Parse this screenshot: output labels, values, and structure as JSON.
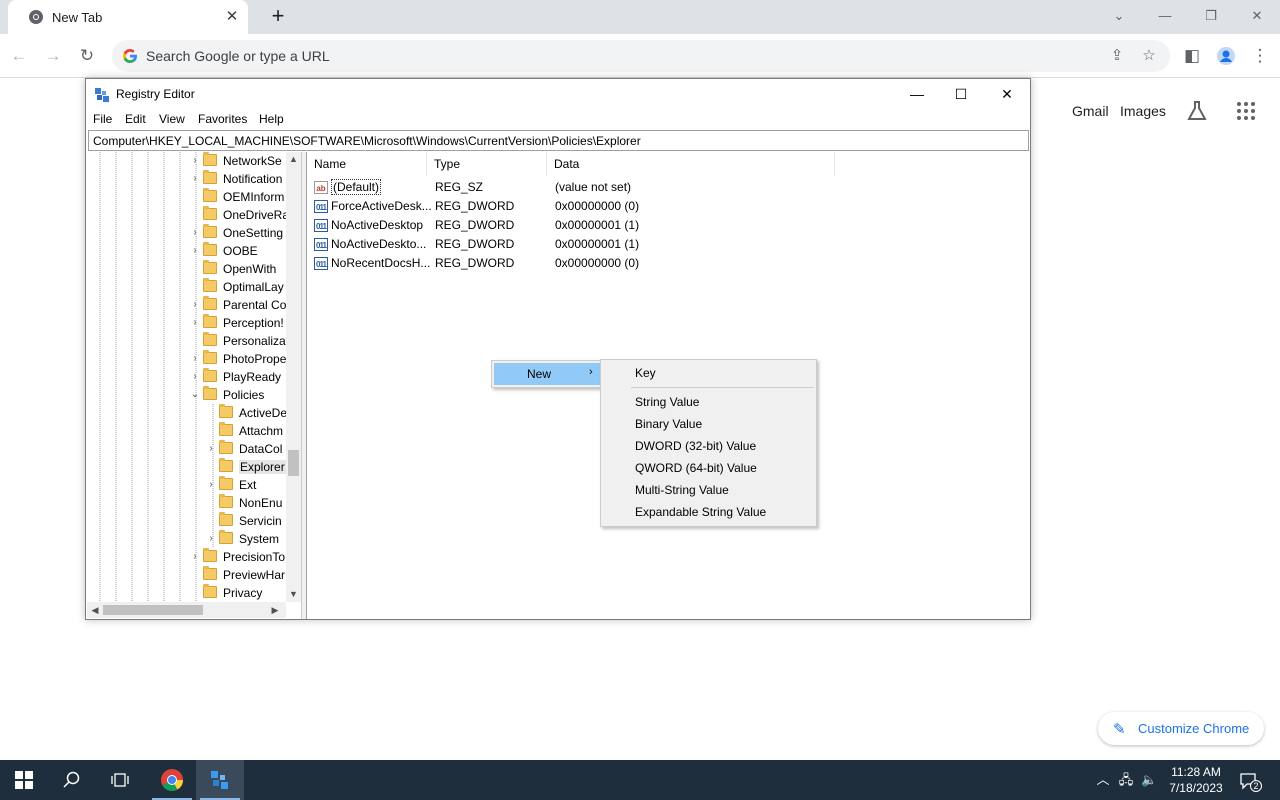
{
  "chrome": {
    "tab_title": "New Tab",
    "tab_close": "✕",
    "new_tab": "+",
    "omnibox_placeholder": "Search Google or type a URL",
    "ntp_links": [
      "Gmail",
      "Images"
    ],
    "customize_label": "Customize Chrome"
  },
  "registry": {
    "title": "Registry Editor",
    "menu": [
      "File",
      "Edit",
      "View",
      "Favorites",
      "Help"
    ],
    "address": "Computer\\HKEY_LOCAL_MACHINE\\SOFTWARE\\Microsoft\\Windows\\CurrentVersion\\Policies\\Explorer",
    "tree": [
      {
        "label": "NetworkSe",
        "expander": "›"
      },
      {
        "label": "Notification",
        "expander": "›"
      },
      {
        "label": "OEMInform",
        "expander": ""
      },
      {
        "label": "OneDriveRa",
        "expander": ""
      },
      {
        "label": "OneSetting",
        "expander": "›"
      },
      {
        "label": "OOBE",
        "expander": "›"
      },
      {
        "label": "OpenWith",
        "expander": ""
      },
      {
        "label": "OptimalLay",
        "expander": ""
      },
      {
        "label": "Parental Co",
        "expander": "›"
      },
      {
        "label": "Perception!",
        "expander": "›"
      },
      {
        "label": "Personaliza",
        "expander": ""
      },
      {
        "label": "PhotoPrope",
        "expander": "›"
      },
      {
        "label": "PlayReady",
        "expander": "›"
      },
      {
        "label": "Policies",
        "expander": "⌄"
      },
      {
        "label": "ActiveDe",
        "expander": ""
      },
      {
        "label": "Attachm",
        "expander": ""
      },
      {
        "label": "DataCol",
        "expander": "›"
      },
      {
        "label": "Explorer",
        "expander": ""
      },
      {
        "label": "Ext",
        "expander": "›"
      },
      {
        "label": "NonEnu",
        "expander": ""
      },
      {
        "label": "Servicin",
        "expander": ""
      },
      {
        "label": "System",
        "expander": "›"
      },
      {
        "label": "PrecisionTo",
        "expander": "›"
      },
      {
        "label": "PreviewHar",
        "expander": ""
      },
      {
        "label": "Privacy",
        "expander": ""
      }
    ],
    "columns": [
      "Name",
      "Type",
      "Data"
    ],
    "values": [
      {
        "icon": "ab",
        "name": "(Default)",
        "type": "REG_SZ",
        "data": "(value not set)"
      },
      {
        "icon": "011",
        "name": "ForceActiveDesk...",
        "type": "REG_DWORD",
        "data": "0x00000000 (0)"
      },
      {
        "icon": "011",
        "name": "NoActiveDesktop",
        "type": "REG_DWORD",
        "data": "0x00000001 (1)"
      },
      {
        "icon": "011",
        "name": "NoActiveDeskto...",
        "type": "REG_DWORD",
        "data": "0x00000001 (1)"
      },
      {
        "icon": "011",
        "name": "NoRecentDocsH...",
        "type": "REG_DWORD",
        "data": "0x00000000 (0)"
      }
    ]
  },
  "context_menu": {
    "new_label": "New",
    "arrow": "›",
    "submenu": [
      "Key",
      "String Value",
      "Binary Value",
      "DWORD (32-bit) Value",
      "QWORD (64-bit) Value",
      "Multi-String Value",
      "Expandable String Value"
    ]
  },
  "taskbar": {
    "time": "11:28 AM",
    "date": "7/18/2023",
    "notification_count": "2"
  },
  "colors": {
    "menu_highlight": "#91c9f7",
    "taskbar": "#1f2e3d",
    "chrome_tabstrip": "#dee1e6"
  }
}
